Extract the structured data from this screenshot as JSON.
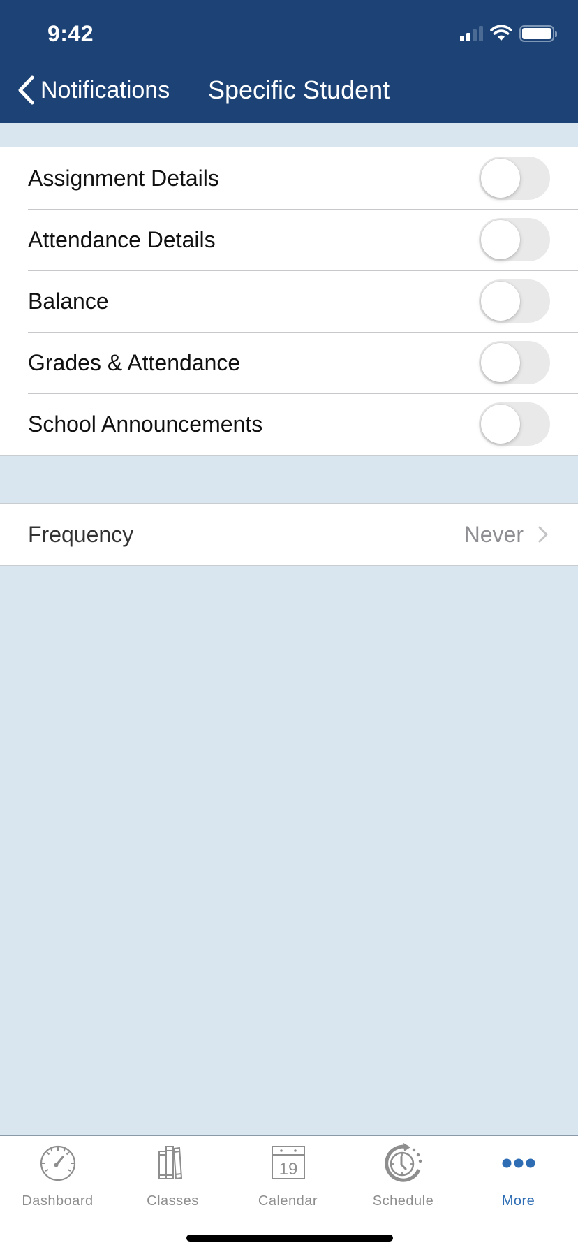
{
  "status_bar": {
    "time": "9:42"
  },
  "nav": {
    "back_label": "Notifications",
    "title": "Specific Student"
  },
  "notification_toggles": [
    {
      "label": "Assignment Details",
      "enabled": false
    },
    {
      "label": "Attendance Details",
      "enabled": false
    },
    {
      "label": "Balance",
      "enabled": false
    },
    {
      "label": "Grades & Attendance",
      "enabled": false
    },
    {
      "label": "School Announcements",
      "enabled": false
    }
  ],
  "frequency": {
    "label": "Frequency",
    "value": "Never"
  },
  "tabbar": {
    "items": [
      {
        "label": "Dashboard",
        "icon": "gauge-icon",
        "active": false
      },
      {
        "label": "Classes",
        "icon": "books-icon",
        "active": false
      },
      {
        "label": "Calendar",
        "icon": "calendar-icon",
        "calendar_day": "19",
        "active": false
      },
      {
        "label": "Schedule",
        "icon": "clock-refresh-icon",
        "active": false
      },
      {
        "label": "More",
        "icon": "more-dots-icon",
        "active": true
      }
    ]
  },
  "colors": {
    "nav_bar": "#1d4376",
    "background": "#d9e6f0",
    "accent": "#2e6db4",
    "inactive_tab": "#8e8e8e"
  }
}
